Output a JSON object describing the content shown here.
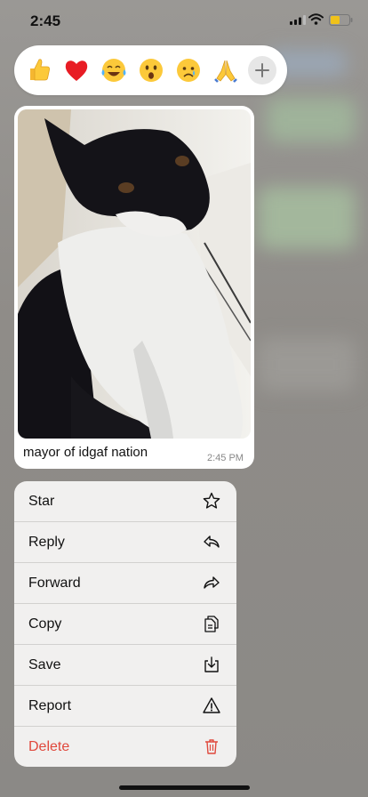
{
  "status_bar": {
    "time": "2:45"
  },
  "reactions": {
    "emojis": [
      "thumbs-up",
      "red-heart",
      "tears-of-joy",
      "surprised",
      "crying",
      "folded-hands"
    ],
    "more_icon": "plus-icon"
  },
  "message": {
    "caption": "mayor of idgaf nation",
    "time": "2:45 PM"
  },
  "menu": {
    "items": [
      {
        "label": "Star",
        "icon": "star-icon"
      },
      {
        "label": "Reply",
        "icon": "reply-icon"
      },
      {
        "label": "Forward",
        "icon": "forward-icon"
      },
      {
        "label": "Copy",
        "icon": "copy-icon"
      },
      {
        "label": "Save",
        "icon": "save-icon"
      },
      {
        "label": "Report",
        "icon": "warning-icon"
      },
      {
        "label": "Delete",
        "icon": "trash-icon"
      }
    ],
    "danger_color": "#e0483c"
  }
}
